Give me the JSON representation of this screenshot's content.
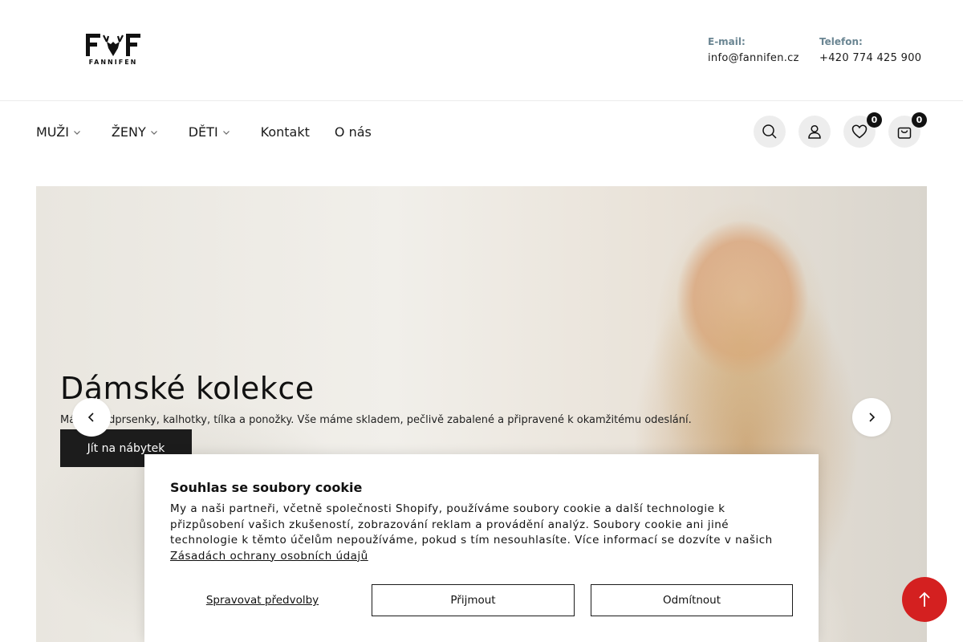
{
  "brand": {
    "logo_text": "FANNIFEN",
    "logo_letters": "F F"
  },
  "contact": {
    "email_label": "E-mail:",
    "email_value": "info@fannifen.cz",
    "phone_label": "Telefon:",
    "phone_value": "+420 774 425 900"
  },
  "nav": {
    "items": [
      {
        "label": "MUŽI",
        "has_dropdown": true
      },
      {
        "label": "ŽENY",
        "has_dropdown": true
      },
      {
        "label": "DĚTI",
        "has_dropdown": true
      },
      {
        "label": "Kontakt",
        "has_dropdown": false
      },
      {
        "label": "O nás",
        "has_dropdown": false
      }
    ]
  },
  "header_icons": {
    "search": "search-icon",
    "account": "user-icon",
    "wishlist": "heart-icon",
    "wishlist_count": "0",
    "cart": "bag-icon",
    "cart_count": "0"
  },
  "hero": {
    "title": "Dámské kolekce",
    "subtitle": "Máme podprsenky, kalhotky, tílka a ponožky. Vše máme skladem, pečlivě zabalené a připravené k okamžitému odeslání.",
    "button_label": "Jít na nábytek"
  },
  "cookie": {
    "title": "Souhlas se soubory cookie",
    "text": "My a naši partneři, včetně společnosti Shopify, používáme soubory cookie a další technologie k přizpůsobení vašich zkušeností, zobrazování reklam a provádění analýz. Soubory cookie ani jiné technologie k těmto účelům nepoužíváme, pokud s tím nesouhlasíte. Více informací se dozvíte v našich",
    "link_label": "Zásadách ochrany osobních údajů",
    "manage_label": "Spravovat předvolby",
    "accept_label": "Přijmout",
    "decline_label": "Odmítnout"
  },
  "colors": {
    "accent_red": "#d42020",
    "contact_label": "#6a8592",
    "button_dark": "#1c1c1c"
  }
}
